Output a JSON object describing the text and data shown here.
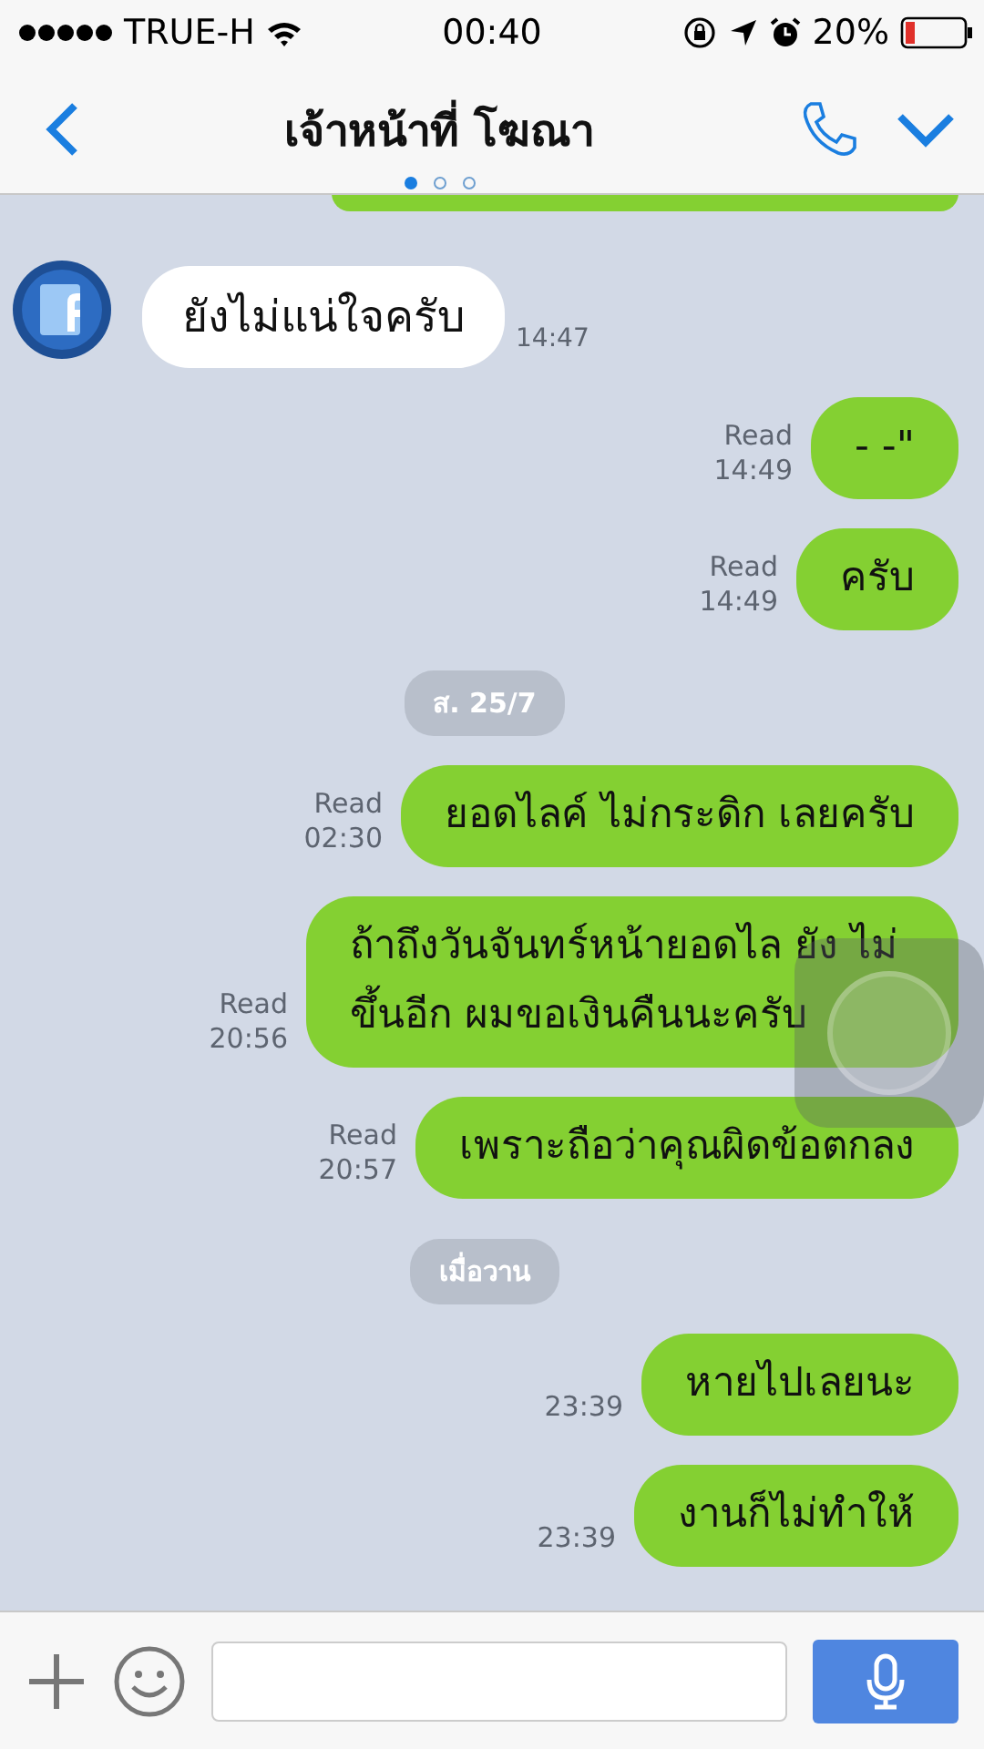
{
  "status_bar": {
    "carrier": "TRUE-H",
    "time": "00:40",
    "battery": "20%"
  },
  "header": {
    "title": "เจ้าหน้าที่ โฆณา",
    "pages": [
      {
        "selected": true
      },
      {
        "selected": false
      },
      {
        "selected": false
      }
    ]
  },
  "messages": [
    {
      "kind": "partial"
    },
    {
      "kind": "in",
      "text": "ยังไม่แน่ใจครับ",
      "time": "14:47"
    },
    {
      "kind": "out",
      "text": "- -\"",
      "read_label": "Read",
      "time": "14:49"
    },
    {
      "kind": "out",
      "text": "ครับ",
      "read_label": "Read",
      "time": "14:49"
    },
    {
      "kind": "date",
      "text": "ส. 25/7"
    },
    {
      "kind": "out",
      "text": "ยอดไลค์ ไม่กระดิก เลยครับ",
      "read_label": "Read",
      "time": "02:30"
    },
    {
      "kind": "out",
      "text": "ถ้าถึงวันจันทร์หน้ายอดไล ยัง ไม่ขึ้นอีก ผมขอเงินคืนนะครับ",
      "read_label": "Read",
      "time": "20:56"
    },
    {
      "kind": "out",
      "text": "เพราะถือว่าคุณผิดข้อตกลง",
      "read_label": "Read",
      "time": "20:57"
    },
    {
      "kind": "date",
      "text": "เมื่อวาน"
    },
    {
      "kind": "out",
      "text": "หายไปเลยนะ",
      "time": "23:39"
    },
    {
      "kind": "out",
      "text": "งานก็ไม่ทำให้",
      "time": "23:39"
    }
  ]
}
